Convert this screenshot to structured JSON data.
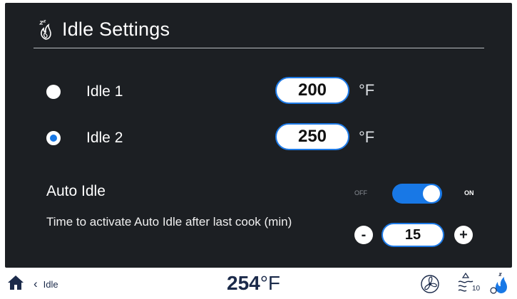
{
  "header": {
    "title": "Idle Settings",
    "icon": "smoke-flame-icon"
  },
  "idle_options": [
    {
      "label": "Idle 1",
      "value": "200",
      "unit": "°F",
      "selected": false
    },
    {
      "label": "Idle 2",
      "value": "250",
      "unit": "°F",
      "selected": true
    }
  ],
  "auto_idle": {
    "label": "Auto Idle",
    "off_label": "OFF",
    "on_label": "ON",
    "enabled": true,
    "description": "Time to activate Auto Idle after last cook (min)",
    "minus": "-",
    "plus": "+",
    "minutes": "15"
  },
  "bottom_bar": {
    "back_label": "Idle",
    "current_temp": "254",
    "temp_unit": "°F",
    "smoke_level": "10"
  },
  "colors": {
    "accent": "#1878e6",
    "screen_bg": "#1c1f23",
    "nav_text": "#1b2a4a"
  }
}
